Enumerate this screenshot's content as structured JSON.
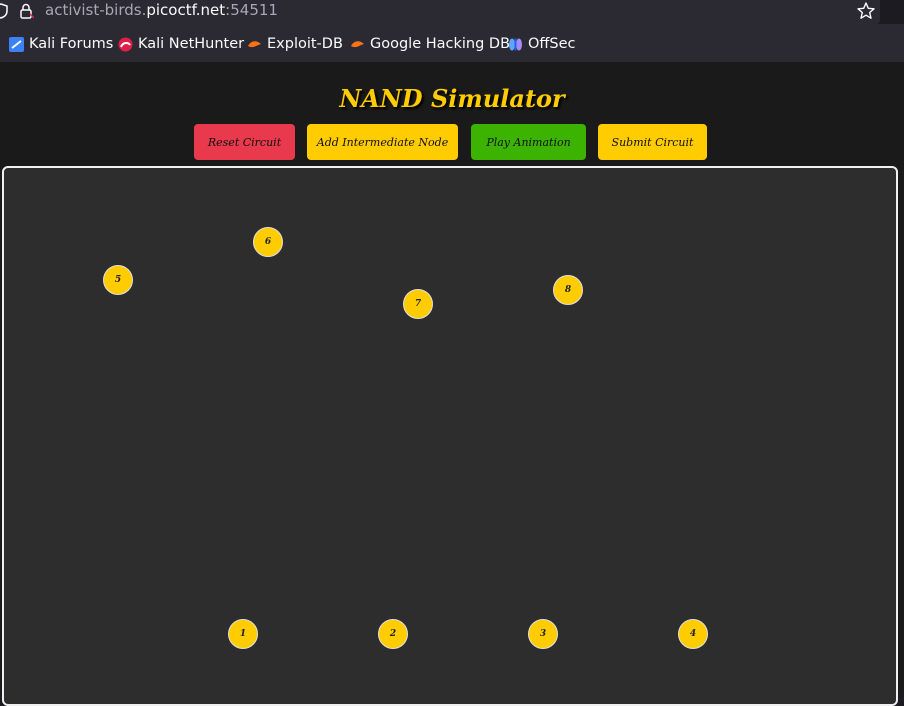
{
  "browser": {
    "url_prefix": "activist-birds.",
    "url_domain": "picoctf.net",
    "url_port": ":54511",
    "bookmarks": [
      {
        "label": "Kali Forums",
        "color": "#3b82f6"
      },
      {
        "label": "Kali NetHunter",
        "color": "#e11d48"
      },
      {
        "label": "Exploit-DB",
        "color": "#f97316"
      },
      {
        "label": "Google Hacking DB",
        "color": "#f97316"
      },
      {
        "label": "OffSec",
        "color": "#60a5fa"
      }
    ]
  },
  "app": {
    "title": "NAND Simulator",
    "buttons": {
      "reset": "Reset Circuit",
      "add_node": "Add Intermediate Node",
      "play": "Play Animation",
      "submit": "Submit Circuit"
    },
    "colors": {
      "accent": "#ffcc00",
      "reset": "#e8394d",
      "play": "#3cb300",
      "canvas": "#2d2d2d"
    },
    "nodes": [
      "1",
      "2",
      "3",
      "4",
      "5",
      "6",
      "7",
      "8"
    ]
  }
}
